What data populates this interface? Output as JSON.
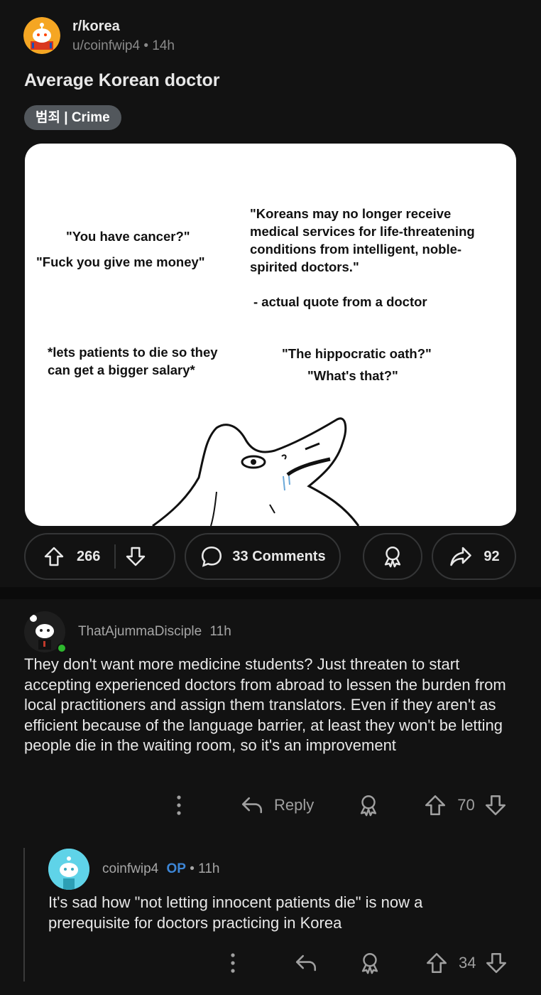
{
  "post": {
    "subreddit": "r/korea",
    "author": "u/coinfwip4",
    "time": "14h",
    "title": "Average Korean doctor",
    "flair": "범죄 | Crime",
    "image_text": {
      "q1a": "\"You have cancer?\"",
      "q1b": "\"Fuck you give me money\"",
      "q2": "\"Koreans may no longer receive medical services for life-threatening conditions from intelligent, noble-spirited doctors.\"",
      "q2_line1": "\"Koreans may no longer receive",
      "q2_line2": "medical services for life-threatening",
      "q2_line3": "conditions from intelligent, noble-",
      "q2_line4": "spirited doctors.\"",
      "q3": "- actual quote from a doctor",
      "q4_line1": "*lets patients to die so they",
      "q4_line2": "can get a bigger salary*",
      "q5a": "\"The hippocratic oath?\"",
      "q5b": "\"What's that?\""
    },
    "upvotes": "266",
    "comments_label": "33 Comments",
    "shares": "92"
  },
  "comments": [
    {
      "user": "ThatAjummaDisciple",
      "time": "11h",
      "body": "They don't want more medicine students? Just threaten to start accepting experienced doctors from abroad to lessen the burden from local practitioners and assign them translators. Even if they aren't as efficient because of the language barrier, at least they won't be letting people die in the waiting room, so it's an improvement",
      "reply_label": "Reply",
      "score": "70"
    },
    {
      "user": "coinfwip4",
      "op_badge": "OP",
      "time": "11h",
      "body": "It's sad how \"not letting innocent patients die\" is now a prerequisite for doctors practicing in Korea",
      "score": "34"
    }
  ],
  "colors": {
    "background": "#121212",
    "accent_op": "#3d86d6",
    "online": "#2eb82e"
  }
}
